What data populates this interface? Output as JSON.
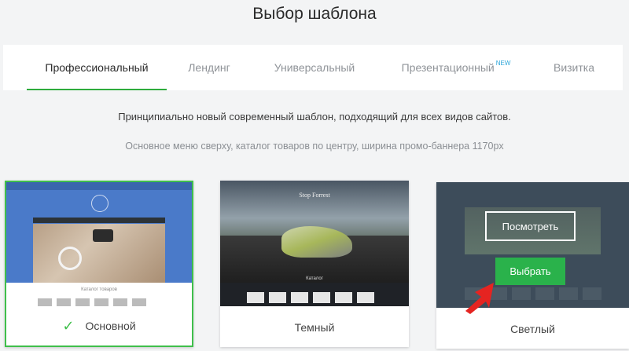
{
  "page": {
    "title": "Выбор шаблона"
  },
  "tabs": [
    {
      "label": "Профессиональный",
      "active": true
    },
    {
      "label": "Лендинг",
      "active": false
    },
    {
      "label": "Универсальный",
      "active": false
    },
    {
      "label": "Презентационный",
      "badge": "NEW",
      "active": false
    },
    {
      "label": "Визитка",
      "active": false
    }
  ],
  "description": {
    "line1": "Принципиально новый современный шаблон, подходящий для всех видов сайтов.",
    "line2": "Основное меню сверху, каталог товаров по центру, ширина промо-баннера 1170px"
  },
  "templates": [
    {
      "name": "Основной",
      "selected": true,
      "preview_catalog_label": "Каталог товаров"
    },
    {
      "name": "Темный",
      "selected": false,
      "preview_logo": "Stop Forrest",
      "preview_catalog_label": "Каталог"
    },
    {
      "name": "Светлый",
      "selected": false,
      "view_button": "Посмотреть",
      "select_button": "Выбрать"
    }
  ],
  "colors": {
    "accent": "#2eac3d",
    "select_button": "#2ab24b",
    "new_badge": "#2aa4d8",
    "arrow": "#e52421"
  }
}
